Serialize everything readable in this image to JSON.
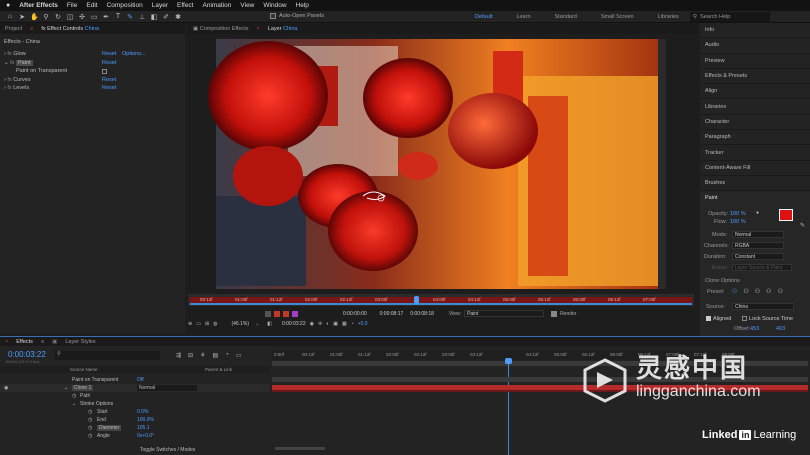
{
  "menubar": {
    "app_name": "After Effects",
    "items": [
      "File",
      "Edit",
      "Composition",
      "Layer",
      "Effect",
      "Animation",
      "View",
      "Window",
      "Help"
    ]
  },
  "toolbar": {
    "auto_open": "Auto-Open Panels",
    "workspaces": [
      "Default",
      "Learn",
      "Standard",
      "Small Screen",
      "Libraries"
    ],
    "search_help": "Search Help"
  },
  "project": {
    "tab": "Project",
    "effect_controls_tab": "Effect Controls",
    "layer_name": "China",
    "header": "Effects - China",
    "effects": [
      {
        "name": "Glow",
        "reset": "Reset",
        "options": "Options..."
      },
      {
        "name": "Paint",
        "reset": "Reset",
        "options": ""
      },
      {
        "name": "Paint on Transparent",
        "reset": "",
        "options": ""
      },
      {
        "name": "Curves",
        "reset": "Reset",
        "options": ""
      },
      {
        "name": "Levels",
        "reset": "Reset",
        "options": ""
      }
    ]
  },
  "viewer": {
    "comp_tab": "Composition Effects",
    "layer_tab": "Layer",
    "layer_name": "China",
    "ruler_labels": [
      "00:12f",
      "01:00f",
      "01:12f",
      "02:00f",
      "02:12f",
      "03:00f",
      "03:12f",
      "04:00f",
      "04:12f",
      "05:00f",
      "05:12f",
      "06:00f",
      "06:12f",
      "07:00f"
    ],
    "zoom": "(46.1%)",
    "timecode": "0:00:03:22",
    "in_time": "0:00:00:00",
    "out_time": "0:00:08:17",
    "duration": "0:00:08:18",
    "view_label": "View:",
    "view_value": "Paint",
    "render_label": "Render",
    "exposure": "+0.0"
  },
  "right_panel": {
    "items": [
      "Info",
      "Audio",
      "Preview",
      "Effects & Presets",
      "Align",
      "Libraries",
      "Character",
      "Paragraph",
      "Tracker",
      "Content-Aware Fill",
      "Brushes"
    ],
    "paint": {
      "title": "Paint",
      "opacity_label": "Opacity:",
      "opacity_value": "100 %",
      "flow_label": "Flow:",
      "flow_value": "100 %",
      "mode_label": "Mode:",
      "mode_value": "Normal",
      "channels_label": "Channels:",
      "channels_value": "RGBA",
      "duration_label": "Duration:",
      "duration_value": "Constant",
      "erase_label": "Erase:",
      "erase_value": "Layer Source & Paint",
      "clone_options": "Clone Options",
      "preset_label": "Preset:",
      "source_label": "Source:",
      "source_value": "China",
      "aligned_label": "Aligned",
      "lock_source_label": "Lock Source Time",
      "offset_label": "Offset:",
      "offset_x": "453",
      "offset_y": "403",
      "color_swatch": "#e01010"
    }
  },
  "timeline": {
    "tab": "Effects",
    "layer_styles_tab": "Layer Styles",
    "timecode": "0:00:03:22",
    "fps": "00094 (23.976 fps)",
    "col_source": "Source Name",
    "col_parent": "Parent & Link",
    "ruler_labels": [
      "0:00f",
      "00:12f",
      "01:00f",
      "01:12f",
      "02:00f",
      "02:12f",
      "03:00f",
      "03:12f",
      "04:00f",
      "04:12f",
      "05:00f",
      "05:12f",
      "06:00f",
      "06:12f",
      "07:00f",
      "07:12f",
      "08:00f"
    ],
    "rows": [
      {
        "name": "Paint on Transparent",
        "value": "Off"
      },
      {
        "name": "Clone 1",
        "value": "Normal"
      },
      {
        "name": "Path",
        "value": ""
      },
      {
        "name": "Stroke Options",
        "value": ""
      },
      {
        "name": "Start",
        "value": "0.0%"
      },
      {
        "name": "End",
        "value": "100.0%"
      },
      {
        "name": "Diameter",
        "value": "105.1"
      },
      {
        "name": "Angle",
        "value": "0x+0.0°"
      }
    ],
    "toggle_label": "Toggle Switches / Modes"
  },
  "watermark": {
    "cn_text": "灵感中国",
    "url": "lingganchina.com"
  },
  "linkedin": {
    "linked": "Linked",
    "in": "in",
    "learning": "Learning"
  }
}
